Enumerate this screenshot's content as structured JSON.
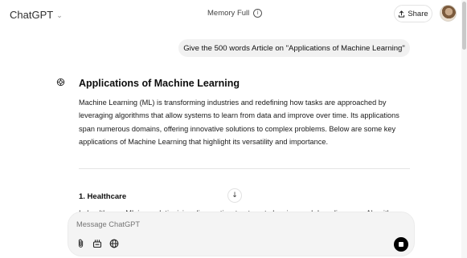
{
  "header": {
    "app_title": "ChatGPT",
    "memory_label": "Memory Full",
    "share_label": "Share",
    "share_icon": "upload-arrow-icon",
    "info_icon_glyph": "i"
  },
  "conversation": {
    "user_message": "Give the 500 words Article on \"Applications of Machine Learning\"",
    "assistant": {
      "title": "Applications of Machine Learning",
      "intro": "Machine Learning (ML) is transforming industries and redefining how tasks are approached by leveraging algorithms that allow systems to learn from data and improve over time. Its applications span numerous domains, offering innovative solutions to complex problems. Below are some key applications of Machine Learning that highlight its versatility and importance.",
      "section_heading": "1. Healthcare",
      "section_text_partial": "In healthcare, ML is revolutionizing diagnostics, treatment planning, and drug discovery. Algorithms"
    }
  },
  "composer": {
    "placeholder": "Message ChatGPT",
    "tools": [
      "attach-icon",
      "tools-icon",
      "globe-icon"
    ]
  },
  "colors": {
    "bubble": "#f1f1f1",
    "composer_bg": "#f4f4f4",
    "stop_button": "#000000"
  }
}
